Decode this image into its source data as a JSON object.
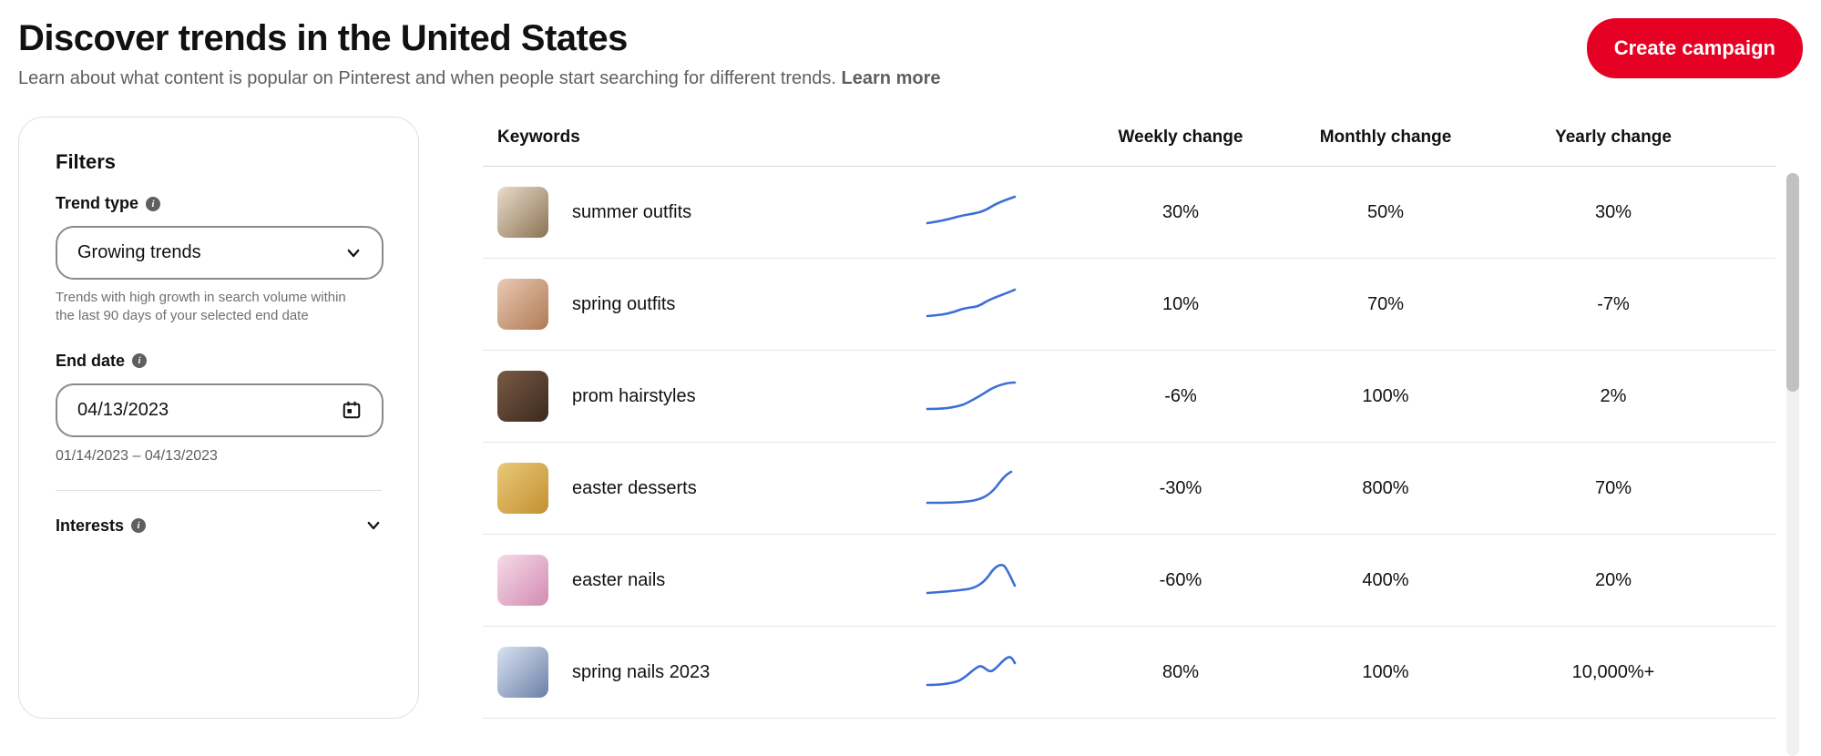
{
  "header": {
    "title": "Discover trends in the United States",
    "subtitle": "Learn about what content is popular on Pinterest and when people start searching for different trends. ",
    "learn_more": "Learn more",
    "create_campaign": "Create campaign"
  },
  "filters": {
    "title": "Filters",
    "trend_type_label": "Trend type",
    "trend_type_value": "Growing trends",
    "trend_type_help": "Trends with high growth in search volume within the last 90 days of your selected end date",
    "end_date_label": "End date",
    "end_date_value": "04/13/2023",
    "date_range": "01/14/2023 – 04/13/2023",
    "interests_label": "Interests"
  },
  "table": {
    "headers": {
      "keywords": "Keywords",
      "weekly": "Weekly change",
      "monthly": "Monthly change",
      "yearly": "Yearly change"
    },
    "rows": [
      {
        "keyword": "summer outfits",
        "weekly": "30%",
        "monthly": "50%",
        "yearly": "30%"
      },
      {
        "keyword": "spring outfits",
        "weekly": "10%",
        "monthly": "70%",
        "yearly": "-7%"
      },
      {
        "keyword": "prom hairstyles",
        "weekly": "-6%",
        "monthly": "100%",
        "yearly": "2%"
      },
      {
        "keyword": "easter desserts",
        "weekly": "-30%",
        "monthly": "800%",
        "yearly": "70%"
      },
      {
        "keyword": "easter nails",
        "weekly": "-60%",
        "monthly": "400%",
        "yearly": "20%"
      },
      {
        "keyword": "spring nails 2023",
        "weekly": "80%",
        "monthly": "100%",
        "yearly": "10,000%+"
      }
    ]
  }
}
